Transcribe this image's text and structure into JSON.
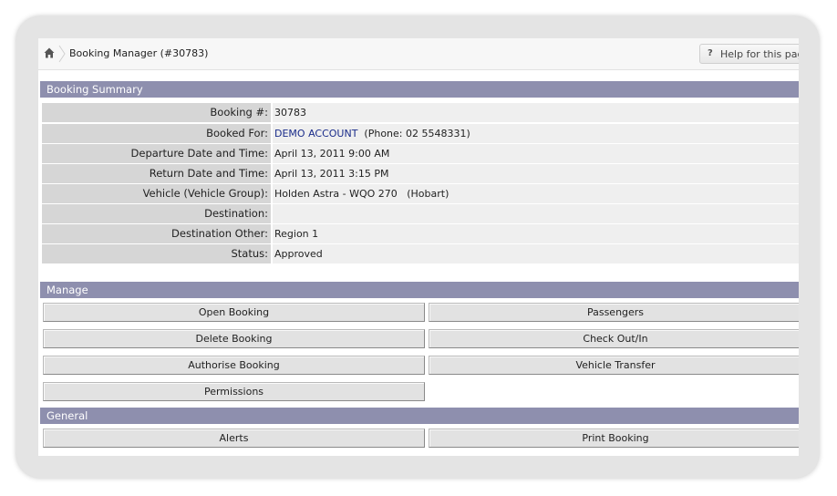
{
  "breadcrumb": {
    "title": "Booking Manager (#30783)",
    "home_icon": "home-icon"
  },
  "help": {
    "label": "Help for this page",
    "icon": "?"
  },
  "summary": {
    "heading": "Booking Summary",
    "rows": [
      {
        "label": "Booking #:",
        "value": "30783"
      },
      {
        "label": "Booked For:",
        "link": "DEMO ACCOUNT",
        "value": "(Phone: 02 5548331)"
      },
      {
        "label": "Departure Date and Time:",
        "value": "April 13, 2011 9:00 AM"
      },
      {
        "label": "Return Date and Time:",
        "value": "April 13, 2011 3:15 PM"
      },
      {
        "label": "Vehicle (Vehicle Group):",
        "value": "Holden Astra - WQO 270   (Hobart)"
      },
      {
        "label": "Destination:",
        "value": ""
      },
      {
        "label": "Destination Other:",
        "value": "Region 1"
      },
      {
        "label": "Status:",
        "value": "Approved"
      }
    ]
  },
  "manage": {
    "heading": "Manage",
    "buttons": [
      "Open Booking",
      "Passengers",
      "Delete Booking",
      "Check Out/In",
      "Authorise Booking",
      "Vehicle Transfer",
      "Permissions"
    ]
  },
  "general": {
    "heading": "General",
    "buttons": [
      "Alerts",
      "Print Booking"
    ]
  },
  "colors": {
    "section_header": "#8e8fae",
    "label_bg": "#d6d6d6",
    "value_bg": "#efefef",
    "link": "#1a2c8a",
    "approved": "#1f7a1f"
  }
}
